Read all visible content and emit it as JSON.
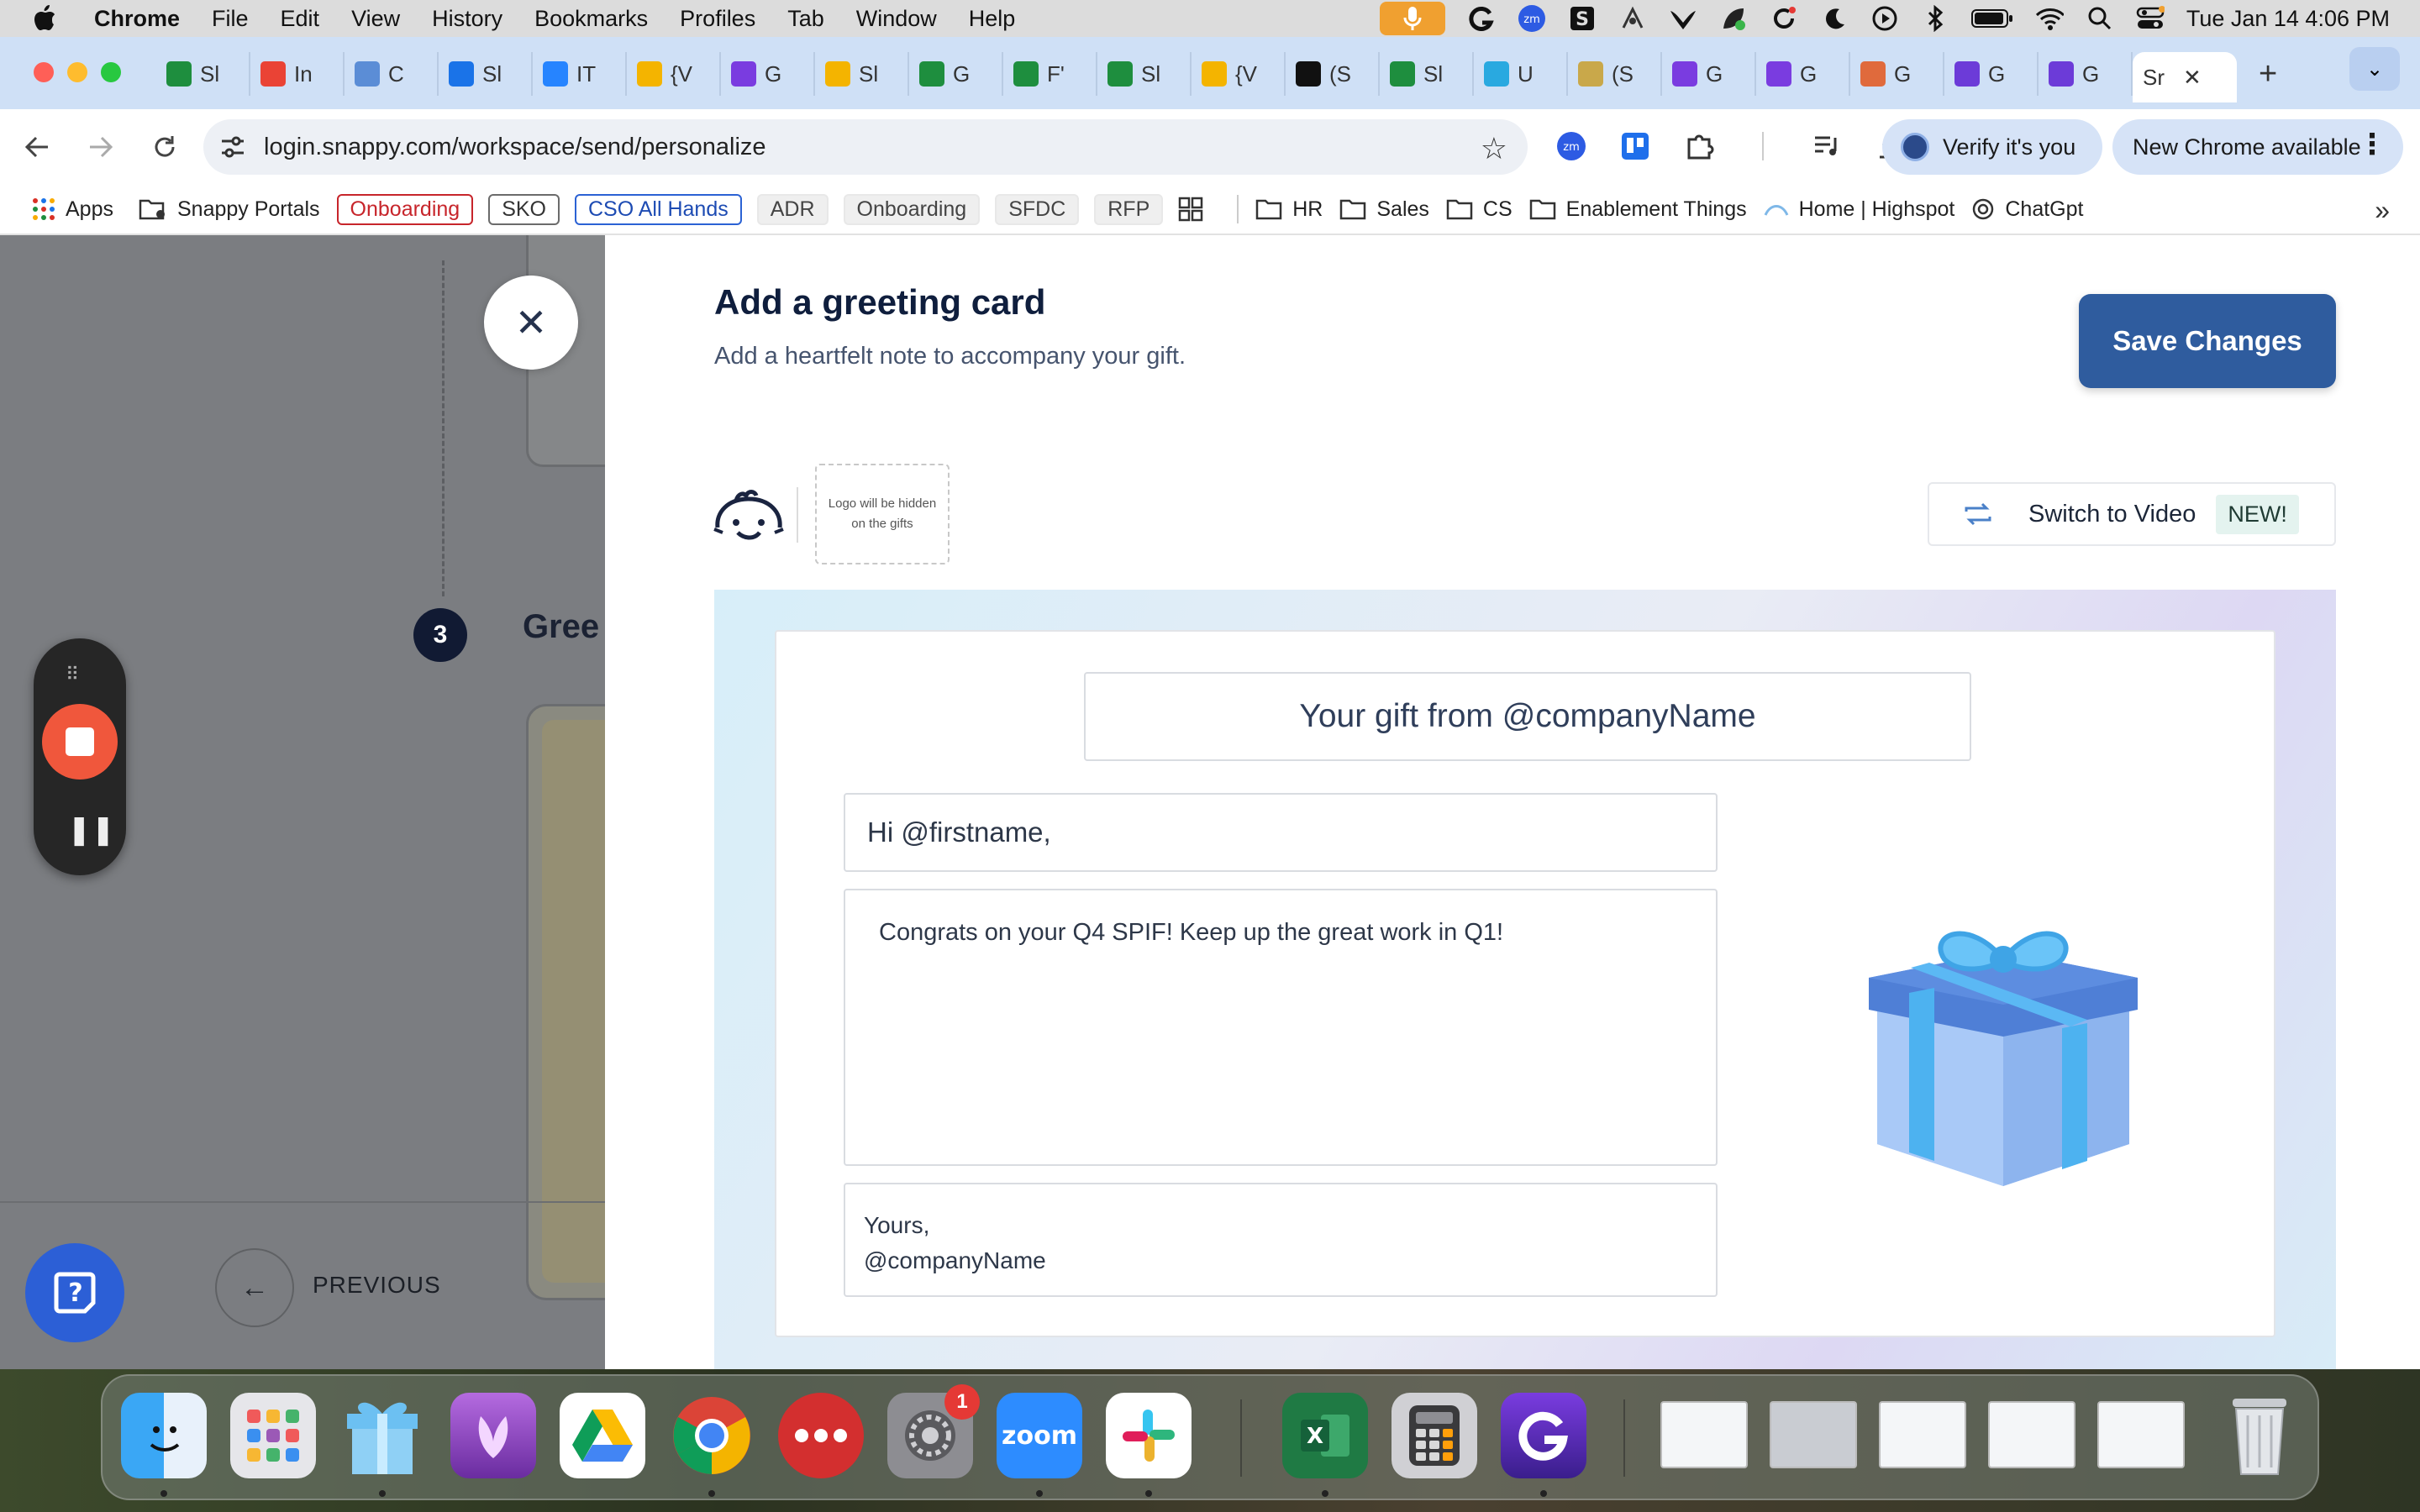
{
  "menubar": {
    "app": "Chrome",
    "items": [
      "File",
      "Edit",
      "View",
      "History",
      "Bookmarks",
      "Profiles",
      "Tab",
      "Window",
      "Help"
    ],
    "clock": "Tue Jan 14  4:06 PM"
  },
  "tabs": [
    {
      "label": "Sl",
      "icon": "sheets-icon",
      "color": "#1e8e3e"
    },
    {
      "label": "In",
      "icon": "gmail-icon",
      "color": "#ea4335"
    },
    {
      "label": "C",
      "icon": "box-icon",
      "color": "#5b8dd6"
    },
    {
      "label": "Sl",
      "icon": "calendar-icon",
      "color": "#1a73e8"
    },
    {
      "label": "IT",
      "icon": "jira-icon",
      "color": "#2684ff"
    },
    {
      "label": "{V",
      "icon": "slides-icon",
      "color": "#f4b400"
    },
    {
      "label": "G",
      "icon": "app-icon",
      "color": "#7a3ce0"
    },
    {
      "label": "Sl",
      "icon": "slides-icon",
      "color": "#f4b400"
    },
    {
      "label": "G",
      "icon": "sheets-icon",
      "color": "#1e8e3e"
    },
    {
      "label": "F'",
      "icon": "sheets-icon",
      "color": "#1e8e3e"
    },
    {
      "label": "Sl",
      "icon": "sheets-icon",
      "color": "#1e8e3e"
    },
    {
      "label": "{V",
      "icon": "slides-icon",
      "color": "#f4b400"
    },
    {
      "label": "(S",
      "icon": "notion-icon",
      "color": "#111111"
    },
    {
      "label": "Sl",
      "icon": "sheets-icon",
      "color": "#1e8e3e"
    },
    {
      "label": "U",
      "icon": "u-icon",
      "color": "#29a9e0"
    },
    {
      "label": "(S",
      "icon": "cash-icon",
      "color": "#c9a84a"
    },
    {
      "label": "G",
      "icon": "app-icon",
      "color": "#7a3ce0"
    },
    {
      "label": "G",
      "icon": "app-icon",
      "color": "#7a3ce0"
    },
    {
      "label": "G",
      "icon": "rainbow-icon",
      "color": "#e06a3c"
    },
    {
      "label": "G",
      "icon": "g-icon",
      "color": "#6c3bd8"
    },
    {
      "label": "G",
      "icon": "g-icon",
      "color": "#6c3bd8"
    }
  ],
  "active_tab": {
    "label": "Sr"
  },
  "address": {
    "url": "login.snappy.com/workspace/send/personalize"
  },
  "toolbar": {
    "verify_label": "Verify it's you",
    "new_chrome_label": "New Chrome available"
  },
  "bookmarks": {
    "apps": "Apps",
    "snappy_portals": "Snappy Portals",
    "onboarding_red": "Onboarding",
    "sko": "SKO",
    "cso": "CSO All Hands",
    "adr": "ADR",
    "onboarding2": "Onboarding",
    "sfdc": "SFDC",
    "rfp": "RFP",
    "hr": "HR",
    "sales": "Sales",
    "cs": "CS",
    "enablement": "Enablement Things",
    "highspot": "Home | Highspot",
    "chatgpt": "ChatGpt"
  },
  "background": {
    "step_number": "3",
    "step_title": "Gree",
    "previous_label": "PREVIOUS"
  },
  "modal": {
    "title": "Add a greeting card",
    "subtitle": "Add a heartfelt note to accompany your gift.",
    "save_label": "Save Changes",
    "logo_placeholder": "Logo will be hidden on the gifts",
    "switch_label": "Switch to Video",
    "new_badge": "NEW!",
    "card": {
      "subject": "Your gift from @companyName",
      "greeting": "Hi @firstname,",
      "message": "Congrats on your Q4 SPIF! Keep up the great work in Q1!",
      "sign_line1": "Yours,",
      "sign_line2": "@companyName"
    }
  },
  "dock": {
    "apps": [
      "Finder",
      "Launchpad",
      "Snappy",
      "Lotus",
      "Google Drive",
      "Chrome",
      "Alfred",
      "System Settings",
      "Zoom",
      "Slack",
      "Excel",
      "Calculator",
      "Glean"
    ],
    "settings_badge": "1",
    "zoom_label": "zoom"
  }
}
